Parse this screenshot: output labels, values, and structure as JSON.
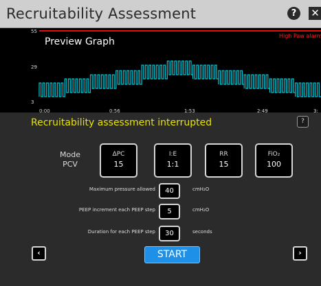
{
  "window": {
    "title": "Recruitability Assessment",
    "help_icon": "question-circle-icon",
    "help_glyph": "?",
    "close_icon": "close-icon",
    "close_glyph": "✕"
  },
  "graph": {
    "title": "Preview Graph",
    "alarm_label": "High Paw alarm",
    "alarm_color": "#e01010",
    "trace_color": "#00c8d8",
    "y_ticks": [
      "55",
      "29",
      "3"
    ],
    "x_ticks": [
      "0:00",
      "0:56",
      "1:53",
      "2:49",
      "3:"
    ]
  },
  "chart_data": {
    "type": "line",
    "title": "Preview Graph",
    "xlabel": "",
    "ylabel": "",
    "ylim": [
      3,
      55
    ],
    "x_tick_labels": [
      "0:00",
      "0:56",
      "1:53",
      "2:49",
      "3:"
    ],
    "threshold": {
      "name": "High Paw alarm",
      "value": 55
    },
    "series": [
      {
        "pattern": "square-wave breaths",
        "segments": [
          {
            "low": 7,
            "high": 17
          },
          {
            "low": 10,
            "high": 20
          },
          {
            "low": 13,
            "high": 23
          },
          {
            "low": 16,
            "high": 26
          },
          {
            "low": 20,
            "high": 30
          },
          {
            "low": 23,
            "high": 33
          },
          {
            "low": 20,
            "high": 30
          },
          {
            "low": 16,
            "high": 26
          },
          {
            "low": 13,
            "high": 23
          },
          {
            "low": 10,
            "high": 20
          },
          {
            "low": 7,
            "high": 17
          }
        ]
      }
    ]
  },
  "status": {
    "message": "Recruitability assessment interrupted",
    "message_color": "#e8e20a",
    "info_button_label": "?"
  },
  "mode": {
    "label": "Mode",
    "value": "PCV"
  },
  "parameters": [
    {
      "name": "ΔPC",
      "value": "15"
    },
    {
      "name": "I:E",
      "value": "1:1"
    },
    {
      "name": "RR",
      "value": "15"
    },
    {
      "name": "FiO₂",
      "value": "100"
    }
  ],
  "settings": [
    {
      "label": "Maximum pressure allowed",
      "value": "40",
      "unit": "cmH₂O"
    },
    {
      "label": "PEEP increment each PEEP step",
      "value": "5",
      "unit": "cmH₂O"
    },
    {
      "label": "Duration for each PEEP step",
      "value": "30",
      "unit": "seconds"
    }
  ],
  "navigation": {
    "prev_glyph": "‹",
    "next_glyph": "›",
    "start_label": "START",
    "start_color": "#1e90e8"
  }
}
